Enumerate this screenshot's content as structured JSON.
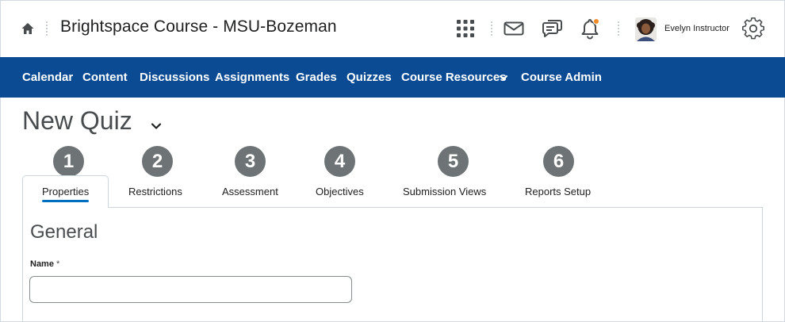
{
  "header": {
    "course_title": "Brightspace Course - MSU-Bozeman",
    "user_name": "Evelyn Instructor",
    "icons": [
      "home-icon",
      "app-grid-icon",
      "mail-icon",
      "chat-icon",
      "bell-icon",
      "settings-gear-icon"
    ],
    "notification_dot_color": "#f18b26"
  },
  "nav": {
    "background_color": "#0b4b94",
    "items": [
      "Calendar",
      "Content",
      "Discussions",
      "Assignments",
      "Grades",
      "Quizzes",
      "Course Resources",
      "Course Admin"
    ]
  },
  "page": {
    "title": "New Quiz"
  },
  "steps": [
    "1",
    "2",
    "3",
    "4",
    "5",
    "6"
  ],
  "tabs": [
    {
      "label": "Properties",
      "active": true
    },
    {
      "label": "Restrictions",
      "active": false
    },
    {
      "label": "Assessment",
      "active": false
    },
    {
      "label": "Objectives",
      "active": false
    },
    {
      "label": "Submission Views",
      "active": false
    },
    {
      "label": "Reports Setup",
      "active": false
    }
  ],
  "form": {
    "section_title": "General",
    "name_label": "Name",
    "required_marker": "*",
    "name_value": ""
  },
  "colors": {
    "accent": "#006fbf",
    "badge": "#6e7376"
  }
}
